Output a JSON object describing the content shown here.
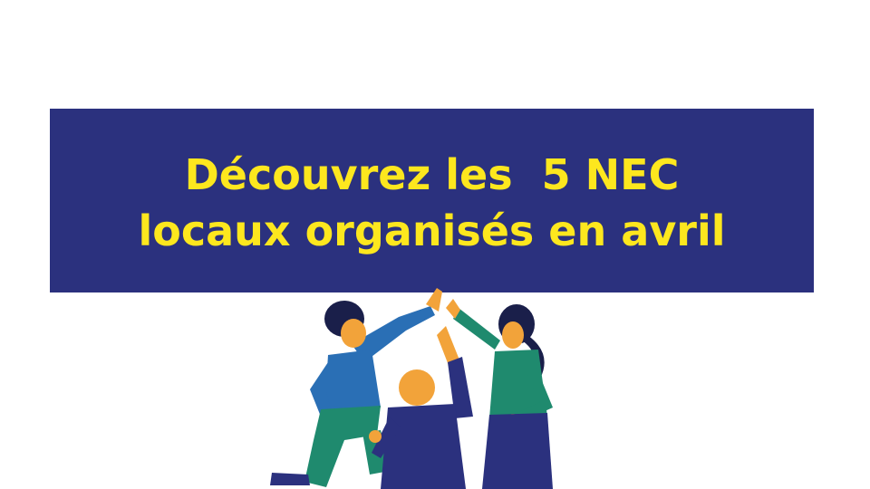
{
  "banner": {
    "line1": "Découvrez les  5 NEC",
    "line2": "locaux organisés en avril"
  },
  "colors": {
    "banner_background": "#2b317e",
    "banner_text": "#fde71e",
    "shirt_blue": "#2a6fb5",
    "pants_green": "#1f8a6e",
    "navy": "#2b317e",
    "skin": "#f2a33a",
    "hair": "#1a1f4a"
  },
  "illustration": {
    "icon": "people-high-five-illustration"
  }
}
